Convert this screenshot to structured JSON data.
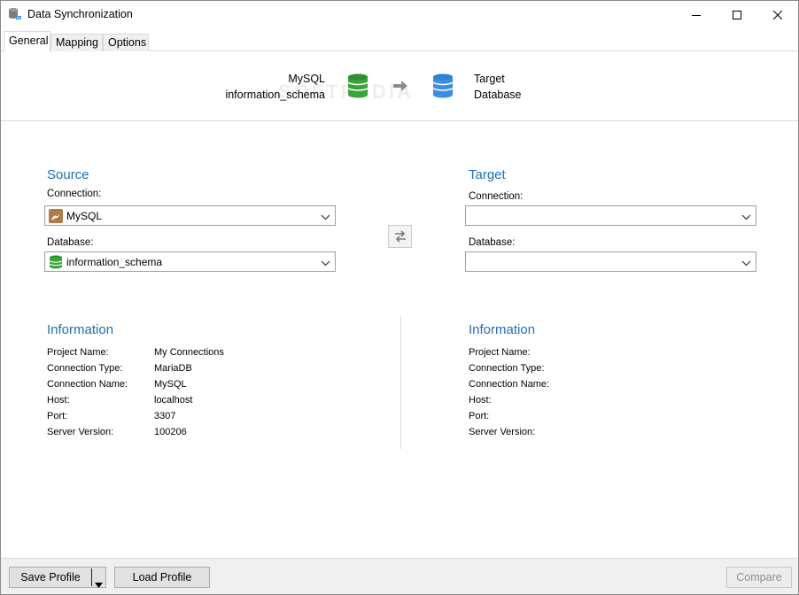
{
  "window": {
    "title": "Data Synchronization",
    "icon": "database-sync-icon"
  },
  "tabs": [
    {
      "label": "General",
      "active": true
    },
    {
      "label": "Mapping",
      "active": false
    },
    {
      "label": "Options",
      "active": false
    }
  ],
  "banner": {
    "source_line1": "MySQL",
    "source_line2": "information_schema",
    "target_line1": "Target",
    "target_line2": "Database",
    "watermark": "SOFTPEDIA",
    "source_icon_color": "#3aa33a",
    "target_icon_color": "#3b8fe0"
  },
  "source": {
    "title": "Source",
    "connection_label": "Connection:",
    "connection_value": "MySQL",
    "database_label": "Database:",
    "database_value": "information_schema"
  },
  "target": {
    "title": "Target",
    "connection_label": "Connection:",
    "connection_value": "",
    "database_label": "Database:",
    "database_value": ""
  },
  "source_info": {
    "title": "Information",
    "rows": [
      {
        "key": "Project Name:",
        "value": "My Connections"
      },
      {
        "key": "Connection Type:",
        "value": "MariaDB"
      },
      {
        "key": "Connection Name:",
        "value": "MySQL"
      },
      {
        "key": "Host:",
        "value": "localhost"
      },
      {
        "key": "Port:",
        "value": "3307"
      },
      {
        "key": "Server Version:",
        "value": "100206"
      }
    ]
  },
  "target_info": {
    "title": "Information",
    "rows": [
      {
        "key": "Project Name:",
        "value": ""
      },
      {
        "key": "Connection Type:",
        "value": ""
      },
      {
        "key": "Connection Name:",
        "value": ""
      },
      {
        "key": "Host:",
        "value": ""
      },
      {
        "key": "Port:",
        "value": ""
      },
      {
        "key": "Server Version:",
        "value": ""
      }
    ]
  },
  "buttons": {
    "save_profile": "Save Profile",
    "load_profile": "Load Profile",
    "compare": "Compare"
  },
  "colors": {
    "accent": "#1e6fb8"
  }
}
